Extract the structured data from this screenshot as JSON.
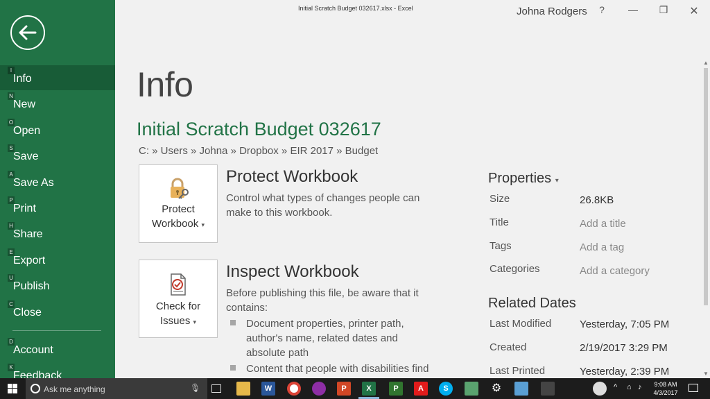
{
  "window": {
    "title": "Initial Scratch Budget 032617.xlsx  -  Excel",
    "user": "Johna Rodgers",
    "help": "?",
    "minimize": "—",
    "restore": "❐",
    "close": "✕"
  },
  "nav": {
    "items": [
      {
        "key": "I",
        "label": "Info"
      },
      {
        "key": "N",
        "label": "New"
      },
      {
        "key": "O",
        "label": "Open"
      },
      {
        "key": "S",
        "label": "Save"
      },
      {
        "key": "A",
        "label": "Save As"
      },
      {
        "key": "P",
        "label": "Print"
      },
      {
        "key": "H",
        "label": "Share"
      },
      {
        "key": "E",
        "label": "Export"
      },
      {
        "key": "U",
        "label": "Publish"
      },
      {
        "key": "C",
        "label": "Close"
      },
      {
        "key": "D",
        "label": "Account"
      },
      {
        "key": "K",
        "label": "Feedback"
      }
    ],
    "active": "Info"
  },
  "main": {
    "title": "Info",
    "file_name": "Initial Scratch Budget 032617",
    "path": "C: » Users » Johna » Dropbox » EIR 2017 » Budget",
    "protect": {
      "button_line1": "Protect",
      "button_line2": "Workbook",
      "heading": "Protect Workbook",
      "description": "Control what types of changes people can make to this workbook."
    },
    "inspect": {
      "button_line1": "Check for",
      "button_line2": "Issues",
      "heading": "Inspect Workbook",
      "description": "Before publishing this file, be aware that it contains:",
      "bullets": [
        "Document properties, printer path, author's name, related dates and absolute path",
        "Content that people with disabilities find"
      ]
    }
  },
  "properties": {
    "heading": "Properties",
    "rows": [
      {
        "label": "Size",
        "value": "26.8KB"
      },
      {
        "label": "Title",
        "value": "Add a title"
      },
      {
        "label": "Tags",
        "value": "Add a tag"
      },
      {
        "label": "Categories",
        "value": "Add a category"
      }
    ],
    "related_heading": "Related Dates",
    "dates": [
      {
        "label": "Last Modified",
        "value": "Yesterday, 7:05 PM"
      },
      {
        "label": "Created",
        "value": "2/19/2017 3:29 PM"
      },
      {
        "label": "Last Printed",
        "value": "Yesterday, 2:39 PM"
      }
    ]
  },
  "taskbar": {
    "search_placeholder": "Ask me anything",
    "time": "9:08 AM",
    "date": "4/3/2017",
    "accent": "#217346"
  }
}
